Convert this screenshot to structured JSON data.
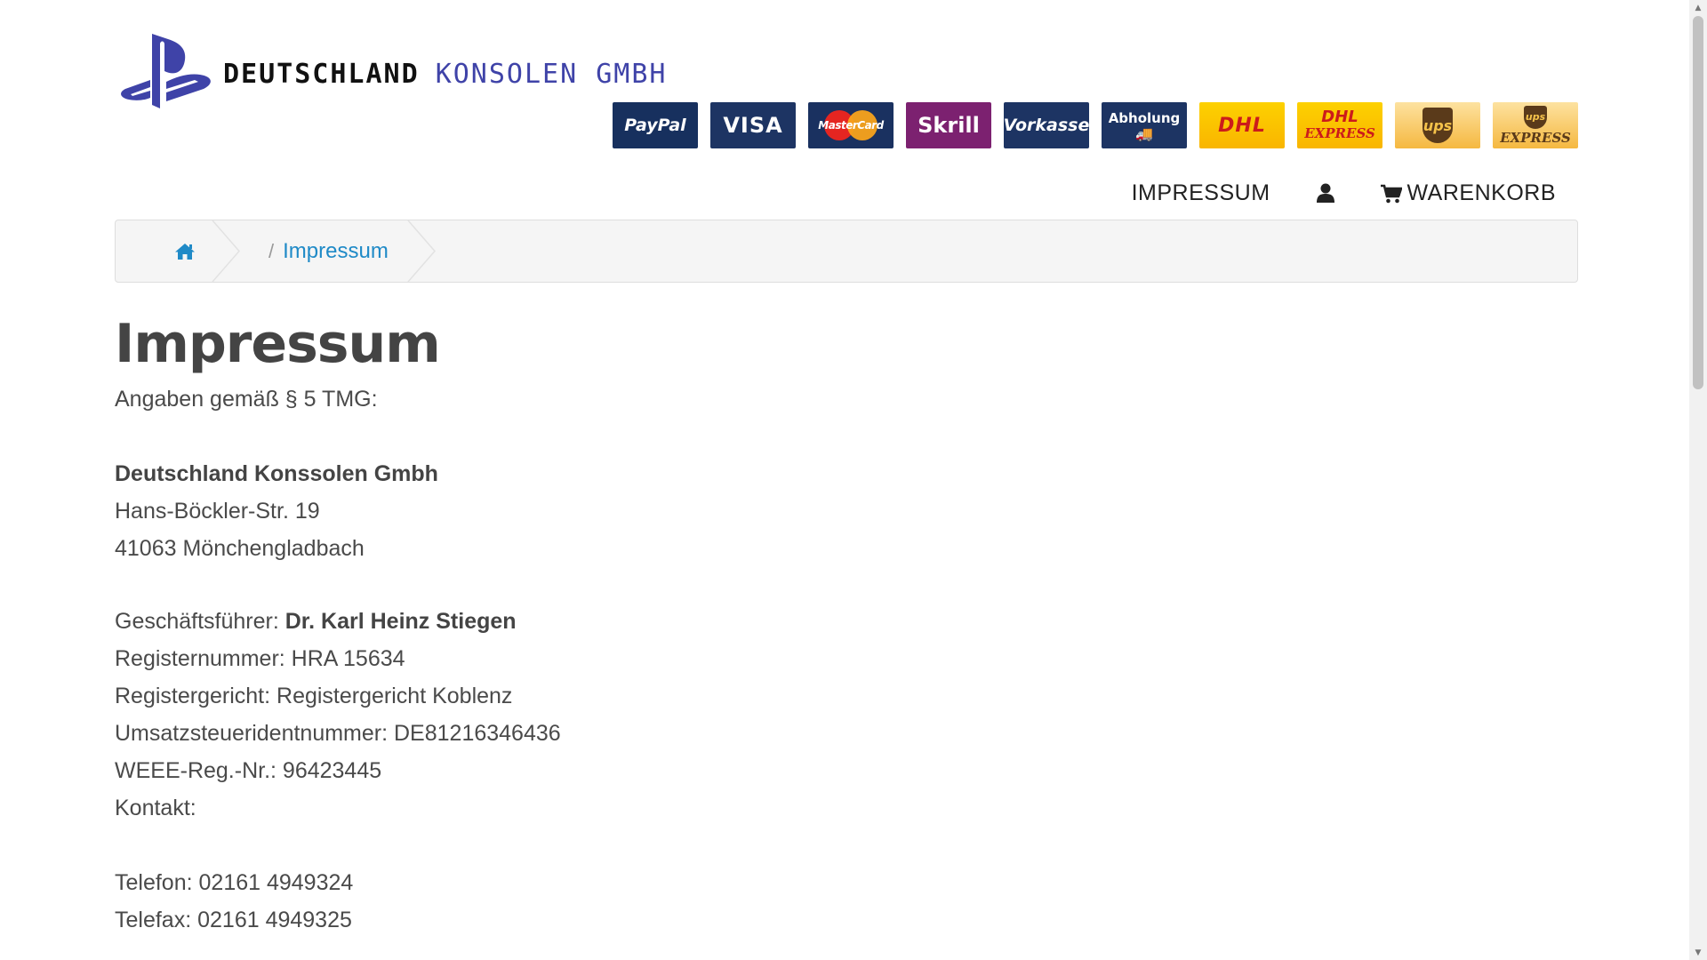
{
  "brand": {
    "word1": "DEUTSCHLAND",
    "word2": "KONSOLEN GMBH",
    "logo_icon": "playstation-logo-icon",
    "colors": {
      "logo_blue": "#3f43a8",
      "dark": "#111111"
    }
  },
  "payments": [
    {
      "key": "paypal",
      "label": "PayPal"
    },
    {
      "key": "visa",
      "label": "VISA"
    },
    {
      "key": "mastercard",
      "label": "MasterCard"
    },
    {
      "key": "skrill",
      "label": "Skrill"
    },
    {
      "key": "vorkasse",
      "label": "Vorkasse"
    },
    {
      "key": "abholung",
      "label": "Abholung"
    },
    {
      "key": "dhl",
      "label": "DHL"
    },
    {
      "key": "dhl_express",
      "label": "DHL",
      "sub": "EXPRESS"
    },
    {
      "key": "ups",
      "label": "ups"
    },
    {
      "key": "ups_express",
      "label": "ups",
      "sub": "EXPRESS"
    }
  ],
  "nav": {
    "impressum": "IMPRESSUM",
    "account_icon": "user-icon",
    "cart_icon": "cart-icon",
    "cart": "WARENKORB"
  },
  "breadcrumb": {
    "home_icon": "home-icon",
    "separator": "/",
    "current": "Impressum"
  },
  "page": {
    "title": "Impressum",
    "intro": "Angaben gemäß § 5 TMG:",
    "company": "Deutschland Konssolen Gmbh",
    "street": "Hans-Böckler-Str. 19",
    "city": "41063 Mönchengladbach",
    "ceo_label": "Geschäftsführer: ",
    "ceo_name": "Dr. Karl Heinz Stiegen",
    "register_number": "Registernummer: HRA 15634",
    "register_court": "Registergericht: Registergericht Koblenz",
    "vat_id": "Umsatzsteueridentnummer: DE81216346436",
    "weee": "WEEE-Reg.-Nr.: 96423445",
    "contact_label": "Kontakt:",
    "phone": "Telefon: 02161 4949324",
    "fax": "Telefax: 02161 4949325"
  }
}
